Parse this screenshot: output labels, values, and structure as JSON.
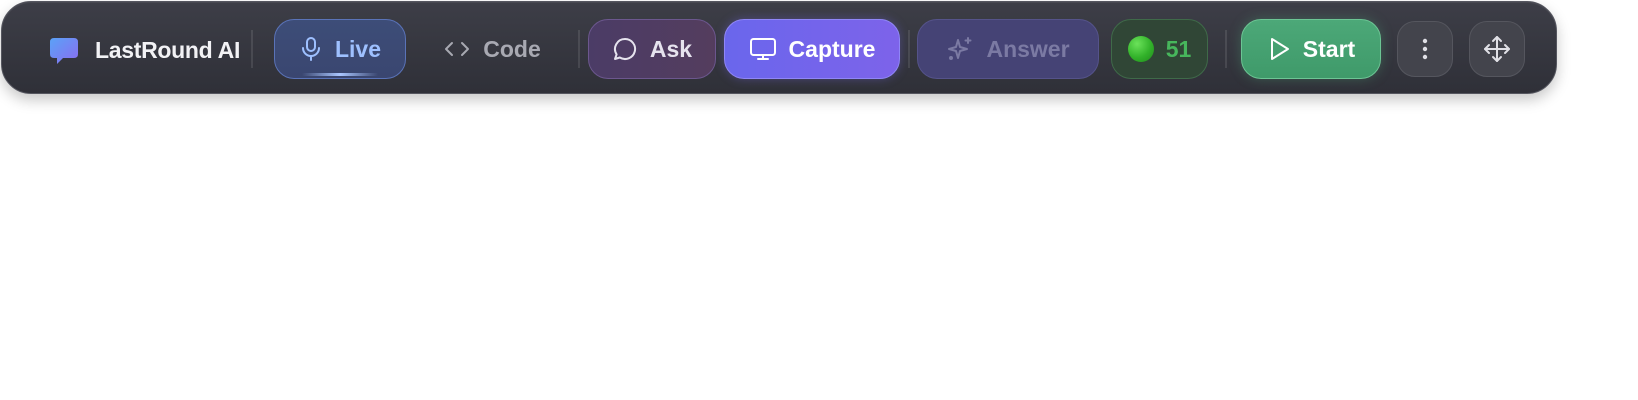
{
  "brand": {
    "name": "LastRound AI",
    "icon": "chat-bubble-icon"
  },
  "toolbar": {
    "live": {
      "label": "Live",
      "icon": "microphone-icon",
      "active": true
    },
    "code": {
      "label": "Code",
      "icon": "code-brackets-icon"
    },
    "ask": {
      "label": "Ask",
      "icon": "chat-icon"
    },
    "capture": {
      "label": "Capture",
      "icon": "monitor-icon"
    },
    "answer": {
      "label": "Answer",
      "icon": "sparkle-icon",
      "disabled": true
    },
    "credits": {
      "value": "51",
      "icon": "green-dot-icon"
    },
    "start": {
      "label": "Start",
      "icon": "play-icon"
    },
    "more": {
      "icon": "vertical-ellipsis-icon"
    },
    "move": {
      "icon": "move-arrows-icon"
    }
  },
  "colors": {
    "toolbar_bg": "#35363e",
    "live_accent": "#9ec0ff",
    "capture_accent": "#6a66ec",
    "start_accent": "#4ca878",
    "credits_accent": "#47b65c"
  }
}
